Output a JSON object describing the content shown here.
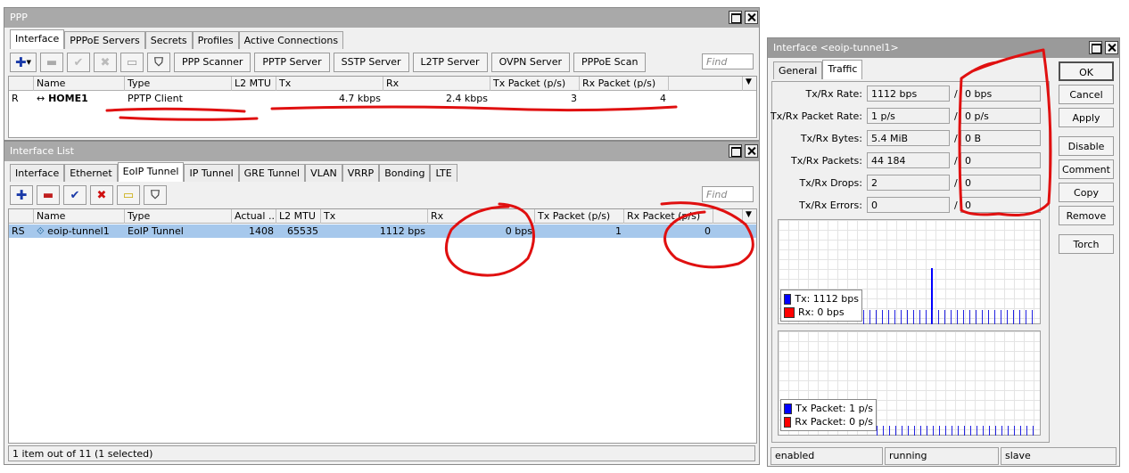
{
  "ppp": {
    "title": "PPP",
    "tabs": [
      "Interface",
      "PPPoE Servers",
      "Secrets",
      "Profiles",
      "Active Connections"
    ],
    "toolbar_buttons": [
      "PPP Scanner",
      "PPTP Server",
      "SSTP Server",
      "L2TP Server",
      "OVPN Server",
      "PPPoE Scan"
    ],
    "find_placeholder": "Find",
    "columns": [
      "Name",
      "Type",
      "L2 MTU",
      "Tx",
      "Rx",
      "Tx Packet (p/s)",
      "Rx Packet (p/s)"
    ],
    "rows": [
      {
        "flag": "R",
        "name": "HOME1",
        "type": "PPTP Client",
        "l2mtu": "",
        "tx": "4.7 kbps",
        "rx": "2.4 kbps",
        "txp": "3",
        "rxp": "4"
      }
    ]
  },
  "iflist": {
    "title": "Interface List",
    "tabs": [
      "Interface",
      "Ethernet",
      "EoIP Tunnel",
      "IP Tunnel",
      "GRE Tunnel",
      "VLAN",
      "VRRP",
      "Bonding",
      "LTE"
    ],
    "find_placeholder": "Find",
    "columns": [
      "Name",
      "Type",
      "Actual ...",
      "L2 MTU",
      "Tx",
      "Rx",
      "Tx Packet (p/s)",
      "Rx Packet (p/s)"
    ],
    "rows": [
      {
        "flag": "RS",
        "name": "eoip-tunnel1",
        "type": "EoIP Tunnel",
        "actual": "1408",
        "l2mtu": "65535",
        "tx": "1112 bps",
        "rx": "0 bps",
        "txp": "1",
        "rxp": "0"
      }
    ],
    "status": "1 item out of 11 (1 selected)"
  },
  "ifdlg": {
    "title": "Interface <eoip-tunnel1>",
    "tabs": [
      "General",
      "Traffic"
    ],
    "rows": [
      {
        "label": "Tx/Rx Rate:",
        "tx": "1112 bps",
        "rx": "0 bps"
      },
      {
        "label": "Tx/Rx Packet Rate:",
        "tx": "1 p/s",
        "rx": "0 p/s"
      },
      {
        "label": "Tx/Rx Bytes:",
        "tx": "5.4 MiB",
        "rx": "0 B"
      },
      {
        "label": "Tx/Rx Packets:",
        "tx": "44 184",
        "rx": "0"
      },
      {
        "label": "Tx/Rx Drops:",
        "tx": "2",
        "rx": "0"
      },
      {
        "label": "Tx/Rx Errors:",
        "tx": "0",
        "rx": "0"
      }
    ],
    "buttons": [
      "OK",
      "Cancel",
      "Apply",
      "Disable",
      "Comment",
      "Copy",
      "Remove",
      "Torch"
    ],
    "legend1": {
      "tx": "Tx:  1112 bps",
      "rx": "Rx:  0 bps"
    },
    "legend2": {
      "tx": "Tx Packet:  1 p/s",
      "rx": "Rx Packet:  0 p/s"
    },
    "status": [
      "enabled",
      "running",
      "slave"
    ]
  },
  "colors": {
    "tx": "#0000ff",
    "rx": "#ff0000",
    "selected_row": "#a6c8ec",
    "annotation": "#e01010"
  }
}
